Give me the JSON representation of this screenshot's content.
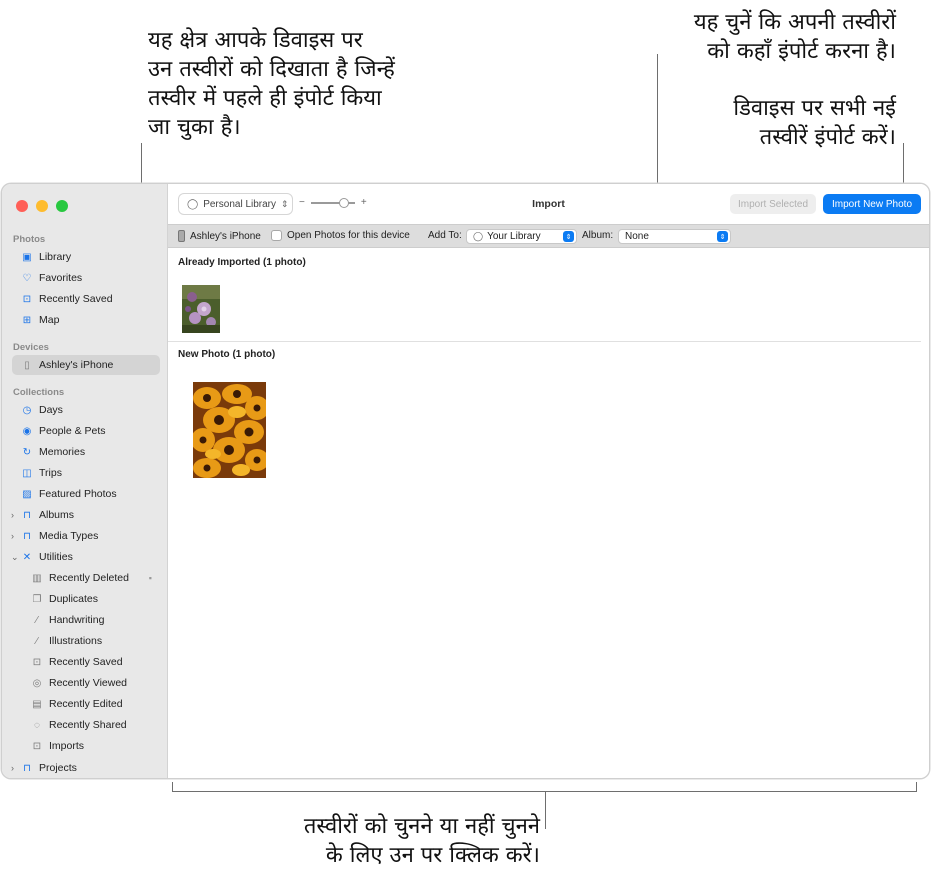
{
  "callouts": {
    "left": [
      "यह क्षेत्र आपके डिवाइस पर",
      "उन तस्वीरों को दिखाता है जिन्हें",
      "तस्वीर में पहले ही इंपोर्ट किया",
      "जा चुका है।"
    ],
    "top_right": [
      "यह चुनें कि अपनी तस्वीरों",
      "को कहाँ इंपोर्ट करना है।"
    ],
    "right": [
      "डिवाइस पर सभी नई",
      "तस्वीरें इंपोर्ट करें।"
    ],
    "bottom": [
      "तस्वीरों को चुनने या नहीं चुनने",
      "के लिए उन पर क्लिक करें।"
    ]
  },
  "window": {
    "traffic_colors": [
      "#ff5f57",
      "#febc2e",
      "#28c840"
    ],
    "title": "Import",
    "library_button": "Personal Library",
    "zoom_minus": "−",
    "zoom_plus": "+",
    "zoom_level": 0.75,
    "import_selected": "Import Selected",
    "import_new": "Import New Photo"
  },
  "toolbar": {
    "device": "Ashley's iPhone",
    "open_photos": "Open Photos for this device",
    "add_to_label": "Add To:",
    "add_to_value": "Your Library",
    "album_label": "Album:",
    "album_value": "None"
  },
  "sidebar": {
    "sections": {
      "photos": "Photos",
      "devices": "Devices",
      "collections": "Collections"
    },
    "photos": [
      {
        "label": "Library",
        "icon": "library-icon"
      },
      {
        "label": "Favorites",
        "icon": "heart-icon"
      },
      {
        "label": "Recently Saved",
        "icon": "tray-icon"
      },
      {
        "label": "Map",
        "icon": "map-icon"
      }
    ],
    "device": "Ashley's iPhone",
    "collections": [
      {
        "label": "Days",
        "icon": "clock-icon"
      },
      {
        "label": "People & Pets",
        "icon": "person-icon"
      },
      {
        "label": "Memories",
        "icon": "memories-icon"
      },
      {
        "label": "Trips",
        "icon": "suitcase-icon"
      },
      {
        "label": "Featured Photos",
        "icon": "photo-icon"
      },
      {
        "label": "Albums",
        "icon": "folder-icon"
      },
      {
        "label": "Media Types",
        "icon": "folder-icon"
      },
      {
        "label": "Utilities",
        "icon": "tools-icon"
      }
    ],
    "utilities": [
      {
        "label": "Recently Deleted",
        "icon": "trash-icon"
      },
      {
        "label": "Duplicates",
        "icon": "duplicate-icon"
      },
      {
        "label": "Handwriting",
        "icon": "pen-icon"
      },
      {
        "label": "Illustrations",
        "icon": "brush-icon"
      },
      {
        "label": "Recently Saved",
        "icon": "tray-icon"
      },
      {
        "label": "Recently Viewed",
        "icon": "eye-icon"
      },
      {
        "label": "Recently Edited",
        "icon": "edit-icon"
      },
      {
        "label": "Recently Shared",
        "icon": "share-icon"
      },
      {
        "label": "Imports",
        "icon": "import-icon"
      }
    ],
    "projects": "Projects"
  },
  "content": {
    "already_imported": "Already Imported (1 photo)",
    "new_photo": "New Photo (1 photo)"
  }
}
